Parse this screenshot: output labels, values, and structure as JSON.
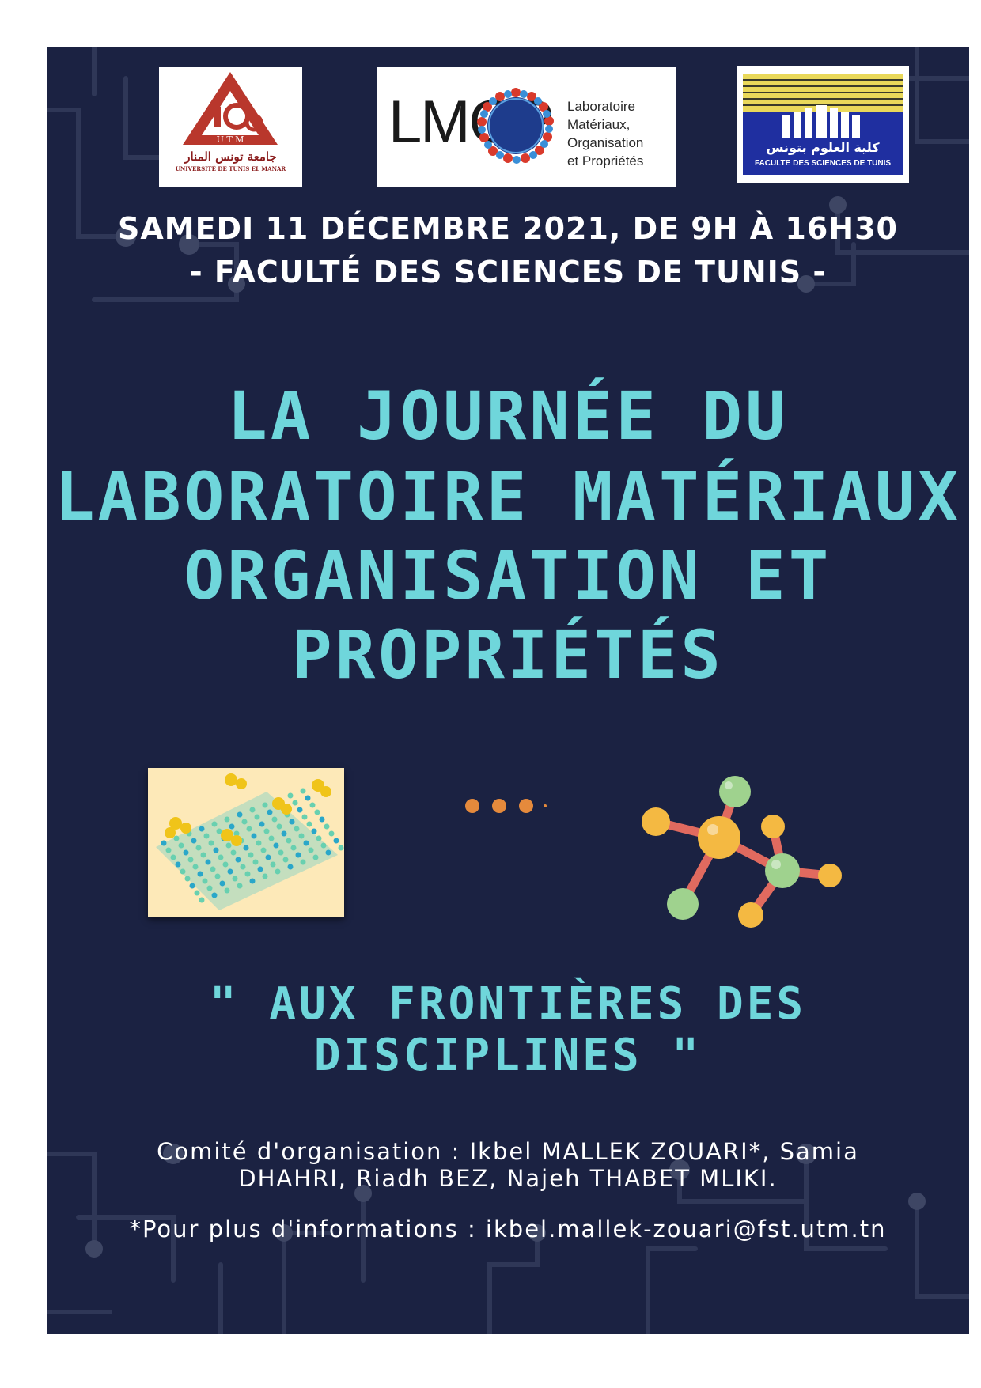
{
  "logos": {
    "utm": {
      "name_ar": "جامعة تونس المنار",
      "name_fr": "UNIVERSITÉ DE TUNIS EL MANAR",
      "letters": "U T M"
    },
    "lmop": {
      "acronym": "LMOP",
      "lines": [
        "Laboratoire",
        "Matériaux,",
        "Organisation",
        "et Propriétés"
      ]
    },
    "fst": {
      "name_ar": "كلية العلوم بتونس",
      "name_fr": "FACULTE DES SCIENCES DE TUNIS"
    }
  },
  "event": {
    "date": "SAMEDI 11 DÉCEMBRE 2021, DE 9H À 16H30",
    "venue": "- FACULTÉ DES SCIENCES DE TUNIS -"
  },
  "title": {
    "line1": "LA JOURNÉE DU",
    "line2": "LABORATOIRE MATÉRIAUX",
    "line3": "ORGANISATION ET",
    "line4": "PROPRIÉTÉS"
  },
  "slogan": "\" AUX FRONTIÈRES DES DISCIPLINES \"",
  "committee": {
    "line1": "Comité d'organisation  : Ikbel MALLEK ZOUARI*, Samia",
    "line2": "DHAHRI,  Riadh BEZ, Najeh THABET MLIKI."
  },
  "contact": "*Pour plus d'informations : ikbel.mallek-zouari@fst.utm.tn",
  "colors": {
    "background": "#1b2242",
    "title": "#6fd6db",
    "text": "#ffffff",
    "dots": "#e58a3c"
  },
  "icons": [
    "utm-logo",
    "lmop-logo",
    "fst-logo",
    "lattice-illustration",
    "ellipsis-dots",
    "molecule-icon"
  ]
}
